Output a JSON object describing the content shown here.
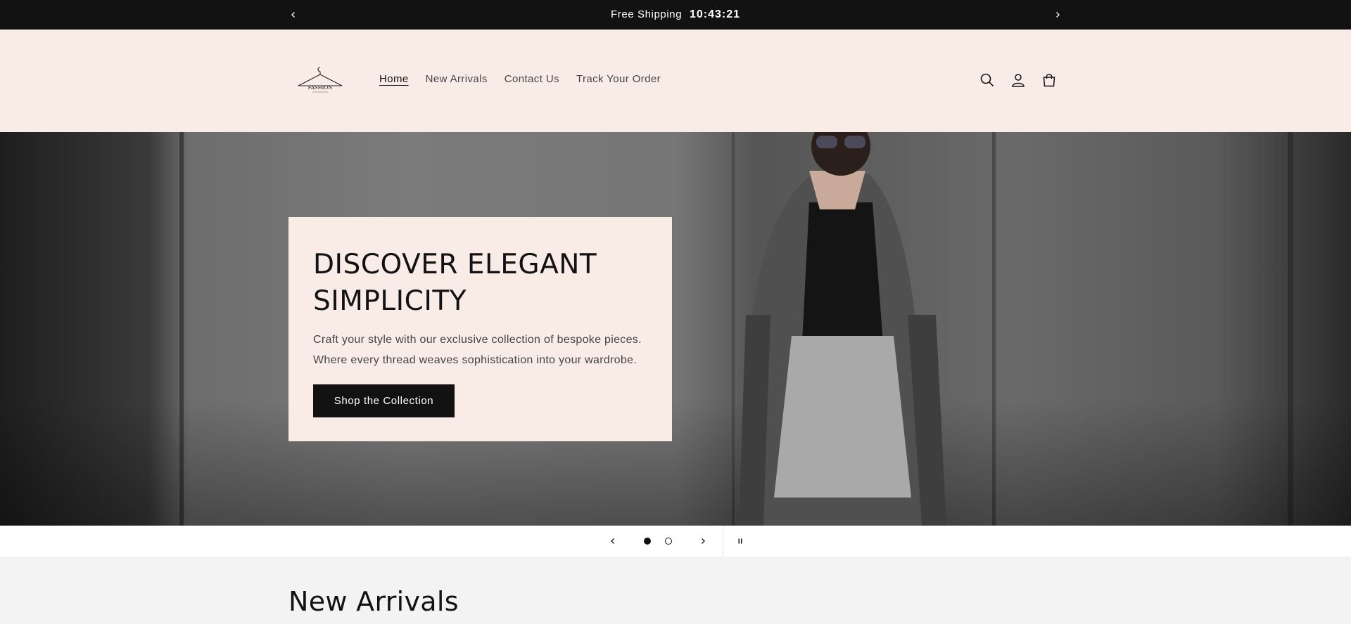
{
  "announcement": {
    "text": "Free Shipping",
    "timer": "10:43:21",
    "prev_icon": "chevron-left-icon",
    "next_icon": "chevron-right-icon"
  },
  "header": {
    "logo_text": "FASHION",
    "nav": [
      {
        "label": "Home",
        "active": true
      },
      {
        "label": "New Arrivals",
        "active": false
      },
      {
        "label": "Contact Us",
        "active": false
      },
      {
        "label": "Track Your Order",
        "active": false
      }
    ],
    "icons": [
      "search-icon",
      "account-icon",
      "cart-icon"
    ]
  },
  "hero": {
    "heading": "DISCOVER ELEGANT SIMPLICITY",
    "text": "Craft your style with our exclusive collection of bespoke pieces. Where every thread weaves sophistication into your wardrobe.",
    "button": "Shop the Collection"
  },
  "slider": {
    "slides": 2,
    "current": 1,
    "pause_icon": "pause-icon"
  },
  "section": {
    "title": "New Arrivals"
  },
  "colors": {
    "dark": "#121212",
    "header_bg": "#f9ece6",
    "page_bg": "#f3f3f3"
  }
}
